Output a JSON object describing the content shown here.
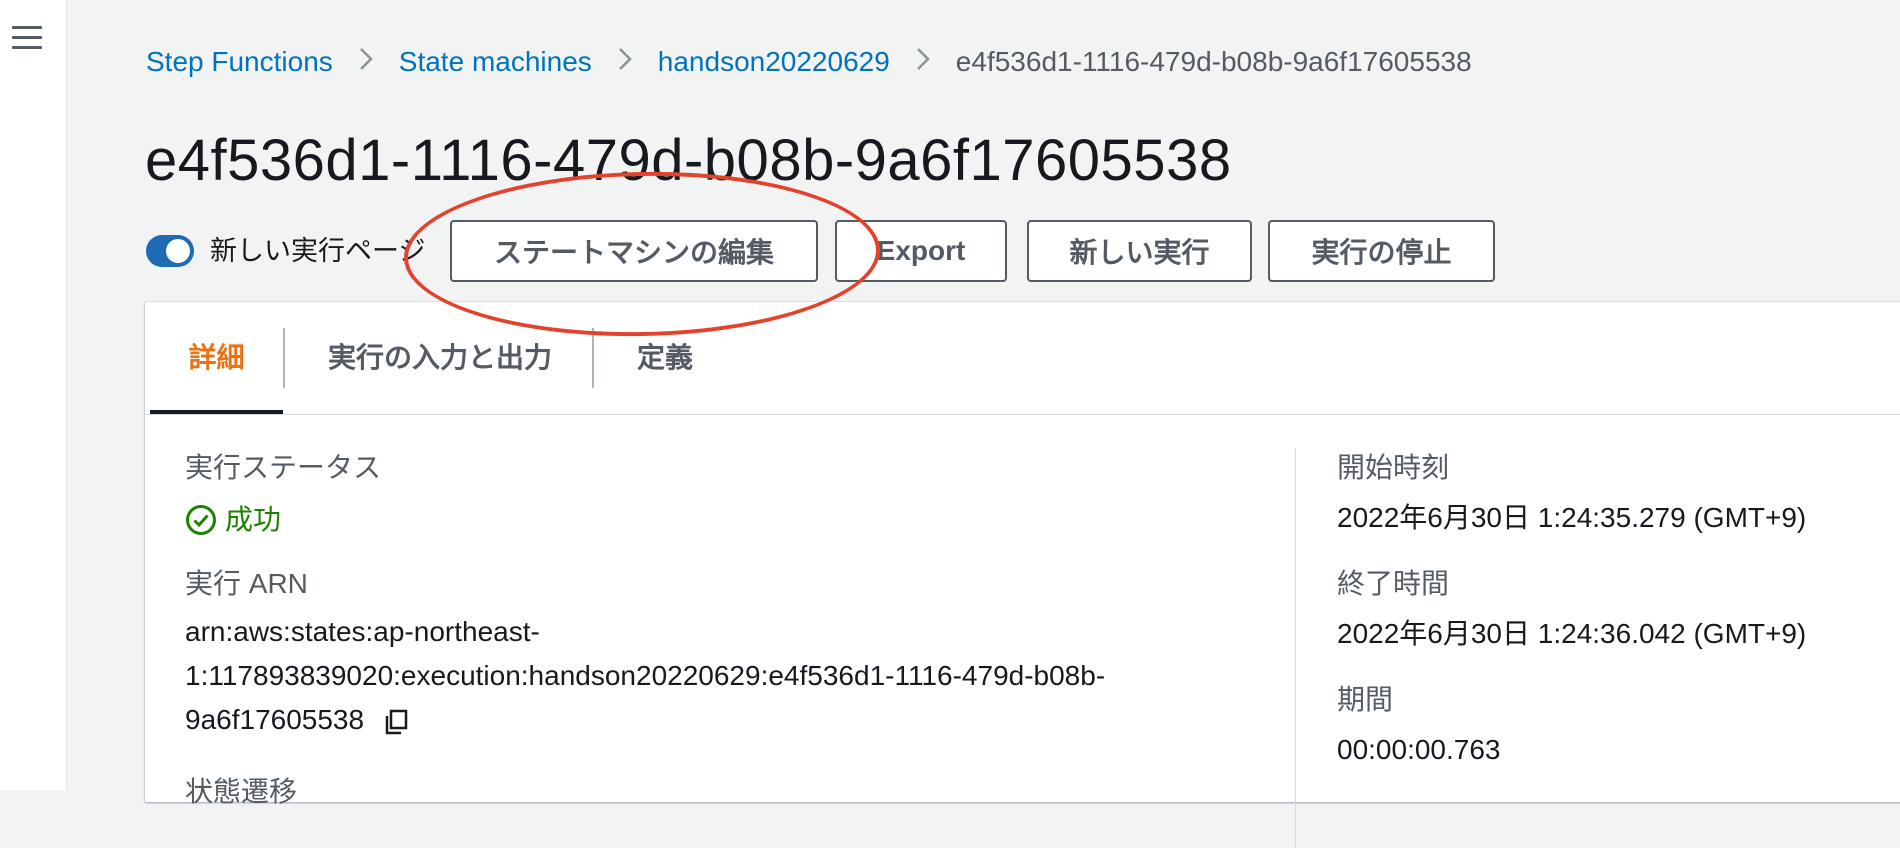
{
  "nav": {
    "menu_icon": "hamburger-menu-icon"
  },
  "breadcrumb": {
    "items": [
      "Step Functions",
      "State machines",
      "handson20220629"
    ],
    "current": "e4f536d1-1116-479d-b08b-9a6f17605538",
    "separator_icon": "chevron-right-icon"
  },
  "page": {
    "title": "e4f536d1-1116-479d-b08b-9a6f17605538"
  },
  "toolbar": {
    "toggle_label": "新しい実行ページ",
    "toggle_on": true,
    "edit_label": "ステートマシンの編集",
    "export_label": "Export",
    "new_execution_label": "新しい実行",
    "stop_label": "実行の停止"
  },
  "tabs": [
    "詳細",
    "実行の入力と出力",
    "定義"
  ],
  "details": {
    "status_label": "実行ステータス",
    "status_value": "成功",
    "status_icon": "success-check-icon",
    "arn_label": "実行 ARN",
    "arn_lines": [
      "arn:aws:states:ap-northeast-",
      "1:117893839020:execution:handson20220629:e4f536d1-1116-479d-b08b-",
      "9a6f17605538"
    ],
    "copy_icon": "copy-icon",
    "transitions_label": "状態遷移",
    "start_label": "開始時刻",
    "start_value": "2022年6月30日 1:24:35.279 (GMT+9)",
    "end_label": "終了時間",
    "end_value": "2022年6月30日 1:24:36.042 (GMT+9)",
    "duration_label": "期間",
    "duration_value": "00:00:00.763"
  },
  "colors": {
    "link": "#0073bb",
    "accent_tab": "#ec7211",
    "success": "#1d8102",
    "toggle": "#1f6ab5",
    "annotation": "#e3432d"
  }
}
